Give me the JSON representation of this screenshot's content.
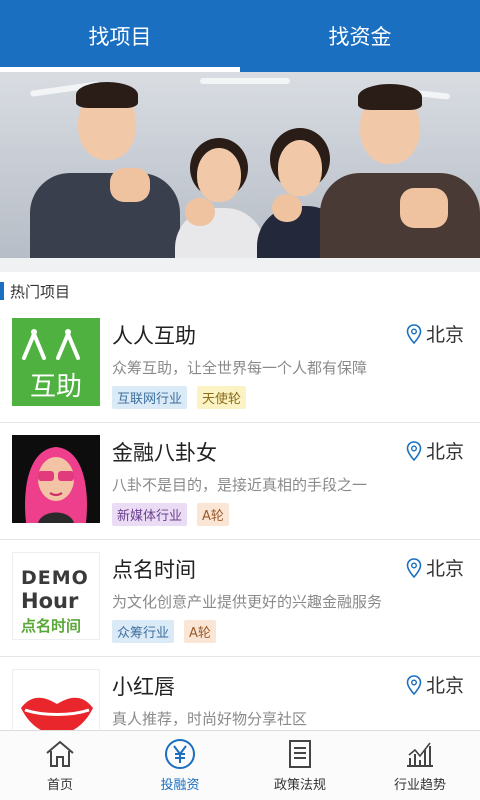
{
  "tabs": [
    {
      "label": "找项目",
      "active": true
    },
    {
      "label": "找资金",
      "active": false
    }
  ],
  "section": {
    "title": "热门项目"
  },
  "projects": [
    {
      "name": "人人互助",
      "desc": "众筹互助，让全世界每一个人都有保障",
      "location": "北京",
      "logo_text": "互助",
      "tags": [
        {
          "label": "互联网行业",
          "bg": "#dbeaf7",
          "fg": "#3d6f9e"
        },
        {
          "label": "天使轮",
          "bg": "#fbf3c4",
          "fg": "#8a6d1a"
        }
      ]
    },
    {
      "name": "金融八卦女",
      "desc": "八卦不是目的，是接近真相的手段之一",
      "location": "北京",
      "logo_text": "",
      "tags": [
        {
          "label": "新媒体行业",
          "bg": "#eadcf5",
          "fg": "#6b3f8f"
        },
        {
          "label": "A轮",
          "bg": "#fbe6d6",
          "fg": "#9a5a2a"
        }
      ]
    },
    {
      "name": "点名时间",
      "desc": "为文化创意产业提供更好的兴趣金融服务",
      "location": "北京",
      "logo_text_1": "DEMO",
      "logo_text_2": "Hour",
      "logo_text_3": "点名时间",
      "tags": [
        {
          "label": "众筹行业",
          "bg": "#dbeaf7",
          "fg": "#3d6f9e"
        },
        {
          "label": "A轮",
          "bg": "#fbe6d6",
          "fg": "#9a5a2a"
        }
      ]
    },
    {
      "name": "小红唇",
      "desc": "真人推荐，时尚好物分享社区",
      "location": "北京",
      "logo_text": "",
      "tags": []
    }
  ],
  "nav": [
    {
      "label": "首页",
      "icon": "home-icon",
      "active": false
    },
    {
      "label": "投融资",
      "icon": "yuan-icon",
      "active": true
    },
    {
      "label": "政策法规",
      "icon": "document-icon",
      "active": false
    },
    {
      "label": "行业趋势",
      "icon": "chart-icon",
      "active": false
    }
  ],
  "colors": {
    "primary": "#1a6fc0",
    "gap": "#f0f1f3"
  }
}
